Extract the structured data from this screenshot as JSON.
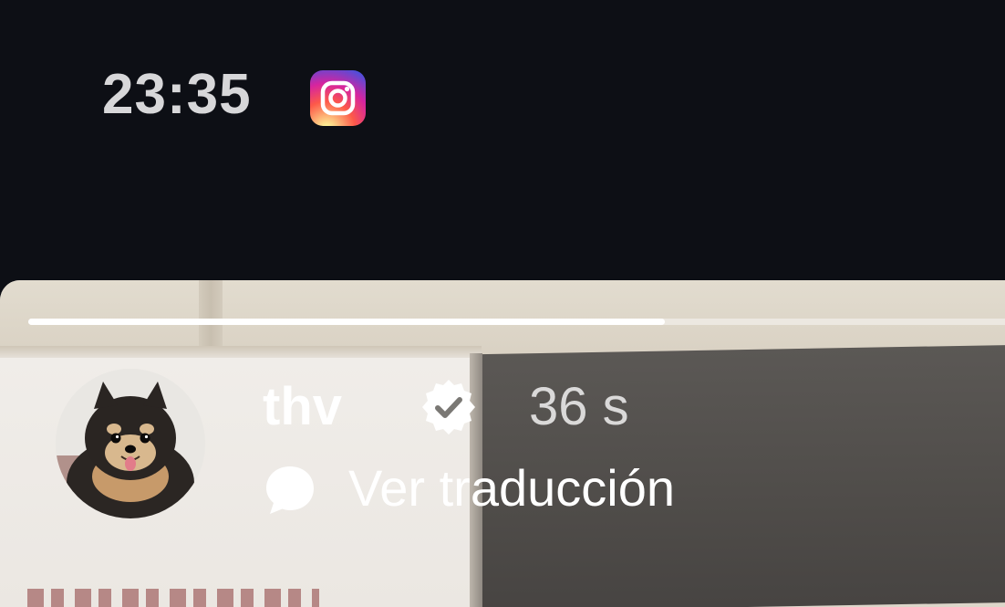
{
  "status_bar": {
    "time": "23:35",
    "notification_icon": "instagram-icon"
  },
  "story": {
    "progress": 0.64,
    "username": "thv",
    "verified_icon": "verified-badge-icon",
    "time_ago": "36 s",
    "translate_icon": "speech-bubble-icon",
    "translate_label": "Ver traducción"
  },
  "colors": {
    "background": "#0d0f15",
    "clock": "#d7d7d9",
    "text": "#ffffff"
  }
}
